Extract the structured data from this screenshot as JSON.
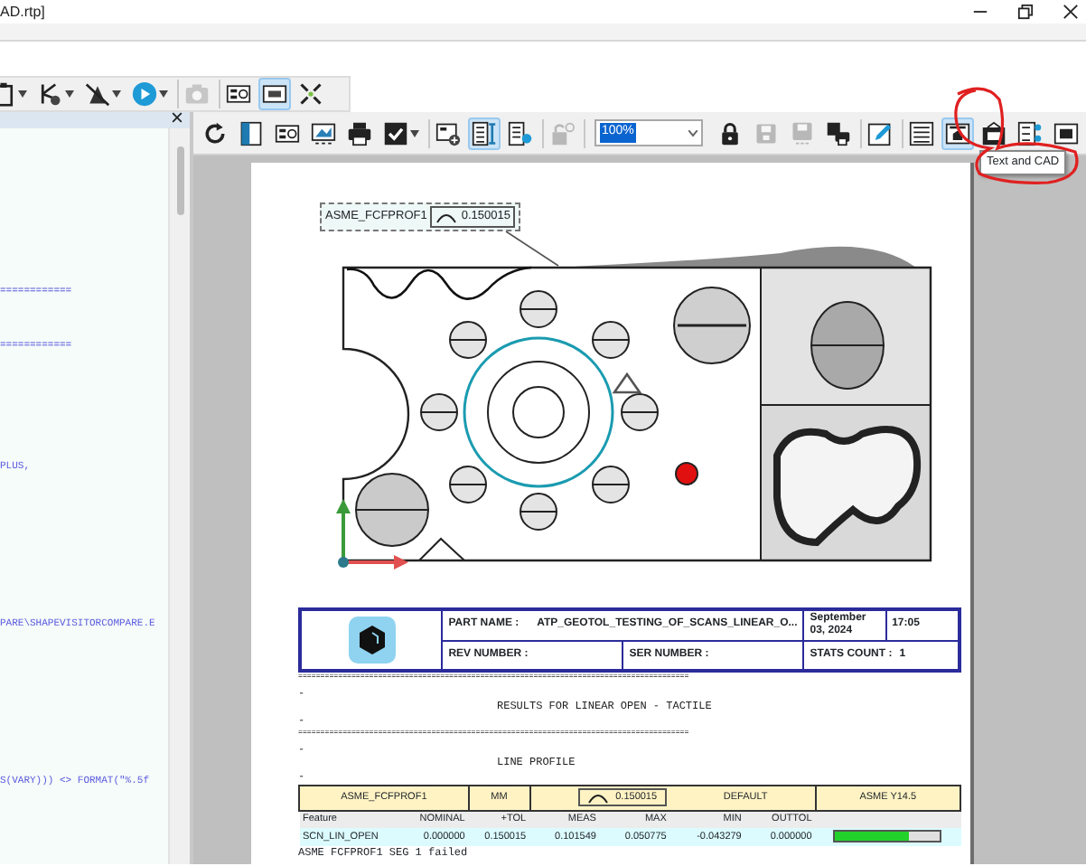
{
  "window": {
    "title": "AD.rtp]"
  },
  "toolbar_1": {
    "buttons": [
      {
        "selected": false,
        "disabled": false,
        "dropdown": true
      },
      {
        "selected": false,
        "disabled": false,
        "dropdown": true
      },
      {
        "selected": false,
        "disabled": false,
        "dropdown": true
      },
      {
        "selected": false,
        "disabled": false,
        "dropdown": true
      },
      {
        "selected": false,
        "disabled": true,
        "dropdown": false
      },
      {
        "selected": false,
        "disabled": false,
        "dropdown": false
      },
      {
        "selected": true,
        "disabled": false,
        "dropdown": false
      },
      {
        "selected": false,
        "disabled": false,
        "dropdown": false
      }
    ]
  },
  "code_panel": {
    "lines": [
      {
        "text": "============"
      },
      {
        "text": "============"
      },
      {
        "text": "PLUS,"
      },
      {
        "text": "PARE\\SHAPEVISITORCOMPARE.E"
      },
      {
        "text": "S(VARY))) <> FORMAT(\"%.5f"
      }
    ]
  },
  "toolbar_2": {
    "buttons": [
      {
        "selected": false,
        "disabled": false,
        "dropdown": false
      },
      {
        "selected": false,
        "disabled": false,
        "dropdown": false
      },
      {
        "selected": false,
        "disabled": false,
        "dropdown": false
      },
      {
        "selected": false,
        "disabled": false,
        "dropdown": false
      },
      {
        "selected": false,
        "disabled": false,
        "dropdown": false
      },
      {
        "selected": false,
        "disabled": false,
        "dropdown": true
      },
      {
        "selected": false,
        "disabled": false,
        "dropdown": false
      },
      {
        "selected": true,
        "disabled": false,
        "dropdown": false
      },
      {
        "selected": false,
        "disabled": false,
        "dropdown": false
      },
      {
        "selected": false,
        "disabled": true,
        "dropdown": false
      }
    ],
    "zoom": {
      "value": "100%"
    },
    "buttons_after": [
      {
        "selected": false,
        "disabled": false,
        "dropdown": false
      },
      {
        "selected": false,
        "disabled": true,
        "dropdown": false
      },
      {
        "selected": false,
        "disabled": true,
        "dropdown": false
      },
      {
        "selected": false,
        "disabled": false,
        "dropdown": false
      },
      {
        "selected": false,
        "disabled": false,
        "dropdown": false
      },
      {
        "selected": false,
        "disabled": false,
        "dropdown": false
      },
      {
        "selected": true,
        "disabled": false,
        "dropdown": false
      },
      {
        "selected": false,
        "disabled": false,
        "dropdown": false
      },
      {
        "selected": false,
        "disabled": false,
        "dropdown": false
      },
      {
        "selected": false,
        "disabled": false,
        "dropdown": false
      }
    ]
  },
  "tooltip": "Text and CAD",
  "report": {
    "callout": {
      "feature": "ASME_FCFPROF1",
      "tolerance": "0.150015"
    },
    "header": {
      "part_name_label": "PART NAME :",
      "part_name": "ATP_GEOTOL_TESTING_OF_SCANS_LINEAR_O...",
      "date": "September 03, 2024",
      "time": "17:05",
      "rev_label": "REV NUMBER :",
      "ser_label": "SER NUMBER :",
      "stats_label": "STATS COUNT :",
      "stats_value": "1"
    },
    "lines": [
      {
        "kind": "rule",
        "text": "========================================================================================"
      },
      {
        "kind": "plain",
        "text": "-"
      },
      {
        "kind": "title",
        "text": "RESULTS FOR LINEAR OPEN - TACTILE"
      },
      {
        "kind": "plain",
        "text": "-"
      },
      {
        "kind": "rule",
        "text": "========================================================================================"
      },
      {
        "kind": "plain",
        "text": "-"
      },
      {
        "kind": "title",
        "text": "LINE PROFILE"
      },
      {
        "kind": "plain",
        "text": "-"
      }
    ],
    "dimension": {
      "feature": "ASME_FCFPROF1",
      "units": "MM",
      "tolerance": "0.150015",
      "datum": "DEFAULT",
      "standard": "ASME Y14.5",
      "columns": [
        "Feature",
        "NOMINAL",
        "+TOL",
        "MEAS",
        "MAX",
        "MIN",
        "OUTTOL"
      ],
      "rows": [
        {
          "cells": [
            "SCN_LIN_OPEN",
            "0.000000",
            "0.150015",
            "0.101549",
            "0.050775",
            "-0.043279",
            "0.000000"
          ],
          "level": 0.7
        }
      ]
    },
    "footer": "ASME FCFPROF1 SEG 1 failed"
  }
}
